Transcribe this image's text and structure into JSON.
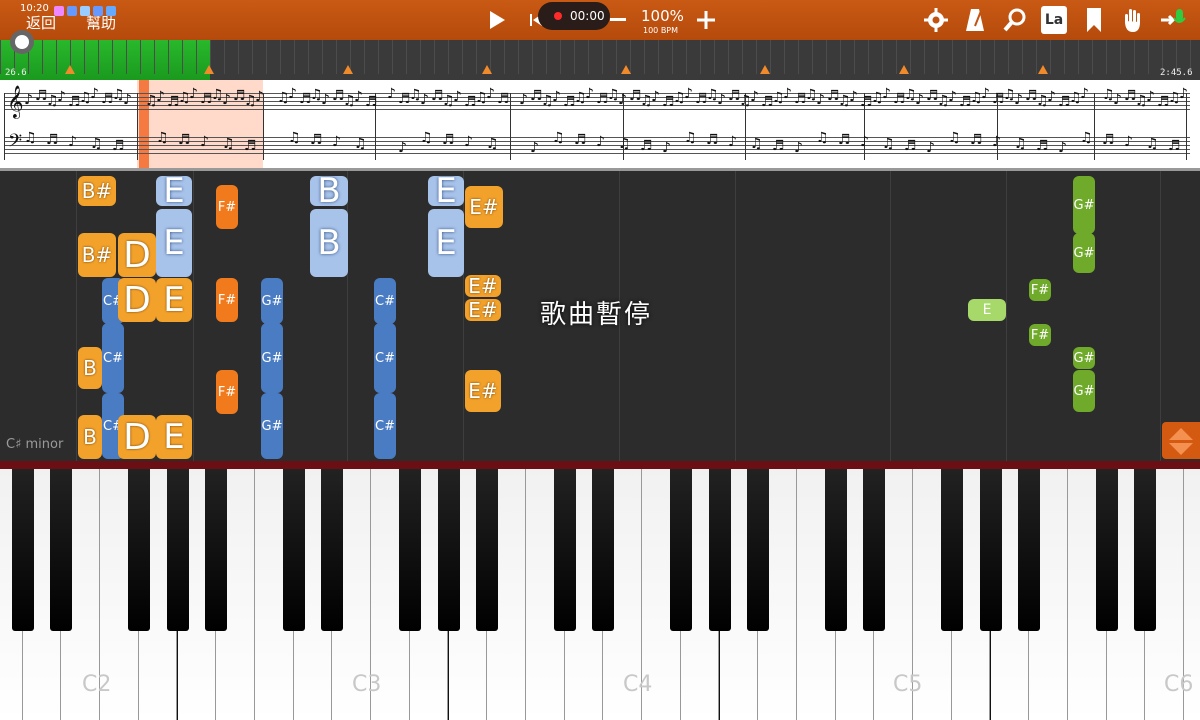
{
  "status_bar": {
    "time": "10:20"
  },
  "toolbar": {
    "back_label": "返回",
    "help_label": "幫助",
    "timer": "00:00",
    "speed": "100%",
    "bpm": "100 BPM",
    "play_icon": "play-icon",
    "plus_icon": "plus-icon",
    "minus_icon": "minus-icon",
    "la_label": "La"
  },
  "progress": {
    "played_fraction": 0.175,
    "start_time": "26.6",
    "end_time": "2:45.6",
    "accent": "#29b82c",
    "marker_color": "#f08a2a"
  },
  "roll": {
    "paused_message": "歌曲暫停",
    "key_label": "C♯ minor",
    "notes": [
      {
        "label": "B#",
        "color": "orange"
      },
      {
        "label": "E",
        "color": "blue"
      },
      {
        "label": "F#",
        "color": "orange2"
      },
      {
        "label": "B",
        "color": "blue"
      },
      {
        "label": "E",
        "color": "blue"
      },
      {
        "label": "E#",
        "color": "orange"
      },
      {
        "label": "G#",
        "color": "green"
      },
      {
        "label": "B#",
        "color": "orange"
      },
      {
        "label": "D",
        "color": "orange"
      },
      {
        "label": "E",
        "color": "blue"
      },
      {
        "label": "B",
        "color": "blue"
      },
      {
        "label": "E",
        "color": "blue"
      },
      {
        "label": "G#",
        "color": "green"
      },
      {
        "label": "C#",
        "color": "blue2"
      },
      {
        "label": "D",
        "color": "orange"
      },
      {
        "label": "E",
        "color": "orange"
      },
      {
        "label": "F#",
        "color": "orange2"
      },
      {
        "label": "G#",
        "color": "blue2"
      },
      {
        "label": "C#",
        "color": "blue2"
      },
      {
        "label": "E#",
        "color": "orange"
      },
      {
        "label": "E#",
        "color": "orange"
      },
      {
        "label": "F#",
        "color": "green"
      },
      {
        "label": "E",
        "color": "lgreen"
      },
      {
        "label": "F#",
        "color": "green"
      },
      {
        "label": "G#",
        "color": "green"
      },
      {
        "label": "B",
        "color": "orange"
      },
      {
        "label": "C#",
        "color": "blue2"
      },
      {
        "label": "F#",
        "color": "orange2"
      },
      {
        "label": "G#",
        "color": "blue2"
      },
      {
        "label": "C#",
        "color": "blue2"
      },
      {
        "label": "E#",
        "color": "orange"
      },
      {
        "label": "G#",
        "color": "green"
      },
      {
        "label": "B",
        "color": "orange"
      },
      {
        "label": "C#",
        "color": "blue2"
      },
      {
        "label": "D",
        "color": "orange"
      },
      {
        "label": "E",
        "color": "orange"
      },
      {
        "label": "G#",
        "color": "blue2"
      },
      {
        "label": "C#",
        "color": "blue2"
      }
    ]
  },
  "keyboard": {
    "octave_labels": [
      "C2",
      "C3",
      "C4",
      "C5",
      "C6"
    ]
  }
}
